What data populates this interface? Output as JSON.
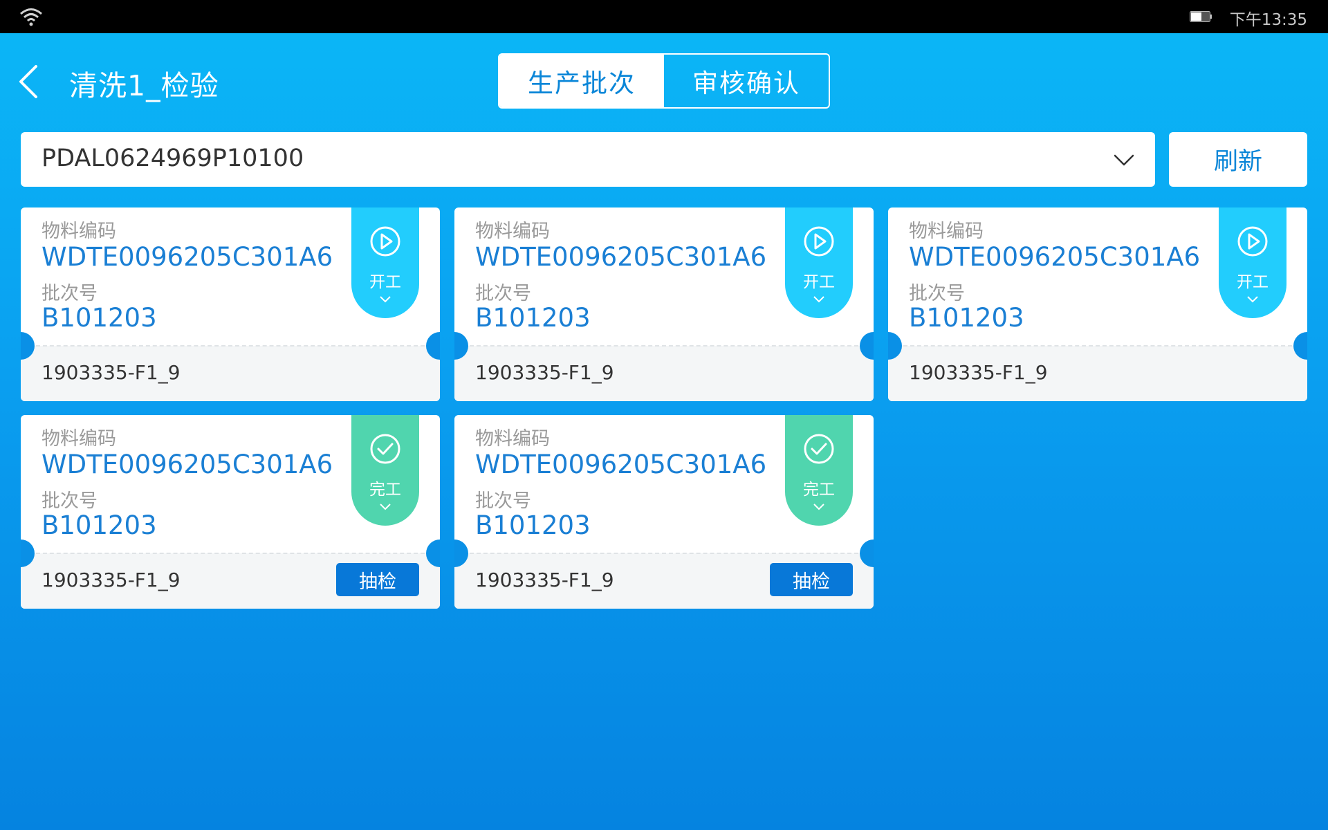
{
  "status_bar": {
    "time": "下午13:35"
  },
  "header": {
    "title": "清洗1_检验",
    "tabs": [
      {
        "label": "生产批次",
        "active": true
      },
      {
        "label": "审核确认",
        "active": false
      }
    ]
  },
  "filter": {
    "selected_batch": "PDAL0624969P10100",
    "refresh_label": "刷新"
  },
  "cards": [
    {
      "material_label": "物料编码",
      "material_code": "WDTE0096205C301A6",
      "batch_label": "批次号",
      "batch_no": "B101203",
      "code": "1903335-F1_9",
      "status": "开工",
      "status_type": "start",
      "action": ""
    },
    {
      "material_label": "物料编码",
      "material_code": "WDTE0096205C301A6",
      "batch_label": "批次号",
      "batch_no": "B101203",
      "code": "1903335-F1_9",
      "status": "开工",
      "status_type": "start",
      "action": ""
    },
    {
      "material_label": "物料编码",
      "material_code": "WDTE0096205C301A6",
      "batch_label": "批次号",
      "batch_no": "B101203",
      "code": "1903335-F1_9",
      "status": "开工",
      "status_type": "start",
      "action": ""
    },
    {
      "material_label": "物料编码",
      "material_code": "WDTE0096205C301A6",
      "batch_label": "批次号",
      "batch_no": "B101203",
      "code": "1903335-F1_9",
      "status": "完工",
      "status_type": "done",
      "action": "抽检"
    },
    {
      "material_label": "物料编码",
      "material_code": "WDTE0096205C301A6",
      "batch_label": "批次号",
      "batch_no": "B101203",
      "code": "1903335-F1_9",
      "status": "完工",
      "status_type": "done",
      "action": "抽检"
    }
  ],
  "colors": {
    "accent": "#0a86d8",
    "start_tag": "#22cdfd",
    "done_tag": "#50d5ae",
    "inspect_button": "#0878d8"
  }
}
